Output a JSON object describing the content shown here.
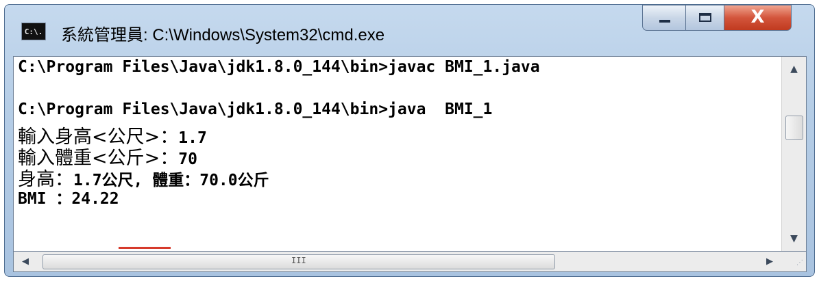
{
  "window": {
    "title": "系統管理員: C:\\Windows\\System32\\cmd.exe",
    "app_icon_text": "C:\\.",
    "buttons": {
      "minimize_icon": "minimize-icon",
      "maximize_icon": "maximize-icon",
      "close_icon": "close-icon",
      "close_glyph": "X"
    }
  },
  "console": {
    "lines": [
      {
        "prefix": "C:\\Program Files\\Java\\jdk1.8.0_144\\bin>javac BMI_1.java",
        "cjk": "",
        "suffix": ""
      },
      {
        "prefix": "",
        "cjk": "",
        "suffix": ""
      },
      {
        "prefix": "C:\\Program Files\\Java\\jdk1.8.0_144\\bin>java  BMI_1",
        "cjk": "",
        "suffix": ""
      },
      {
        "prefix": "",
        "cjk": "輸入身高<公尺>：",
        "suffix": "1.7"
      },
      {
        "prefix": "",
        "cjk": "輸入體重<公斤>：",
        "suffix": "70"
      },
      {
        "prefix": "",
        "cjk": "身高：",
        "suffix": "1.7公尺, 體重：70.0公斤"
      },
      {
        "prefix": "BMI ：24.22",
        "cjk": "",
        "suffix": ""
      }
    ]
  },
  "scrollbars": {
    "up_arrow": "▲",
    "down_arrow": "▼",
    "left_arrow": "◀",
    "right_arrow": "▶",
    "h_grip": "III",
    "resize_grip": "⋰"
  },
  "colors": {
    "cursor": "#d63a2c",
    "close_button": "#c13a1f"
  }
}
